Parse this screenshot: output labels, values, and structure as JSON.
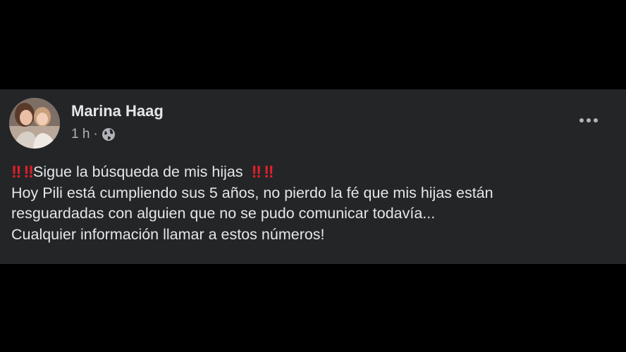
{
  "post": {
    "author": "Marina Haag",
    "time": "1 h",
    "separator": "·",
    "privacy_icon": "globe-icon",
    "menu_icon": "more-horizontal-icon",
    "emoji": "‼",
    "lines": [
      "Sigue la búsqueda de mis hijas",
      "Hoy Pili está cumpliendo sus 5 años, no pierdo la fé que mis hijas están",
      "resguardadas con alguien que no se pudo comunicar todavía...",
      "Cualquier información llamar a estos números!"
    ]
  },
  "colors": {
    "background": "#000000",
    "card": "#242526",
    "primary_text": "#e4e6eb",
    "secondary_text": "#b0b3b8",
    "emoji_red": "#e0202c"
  }
}
